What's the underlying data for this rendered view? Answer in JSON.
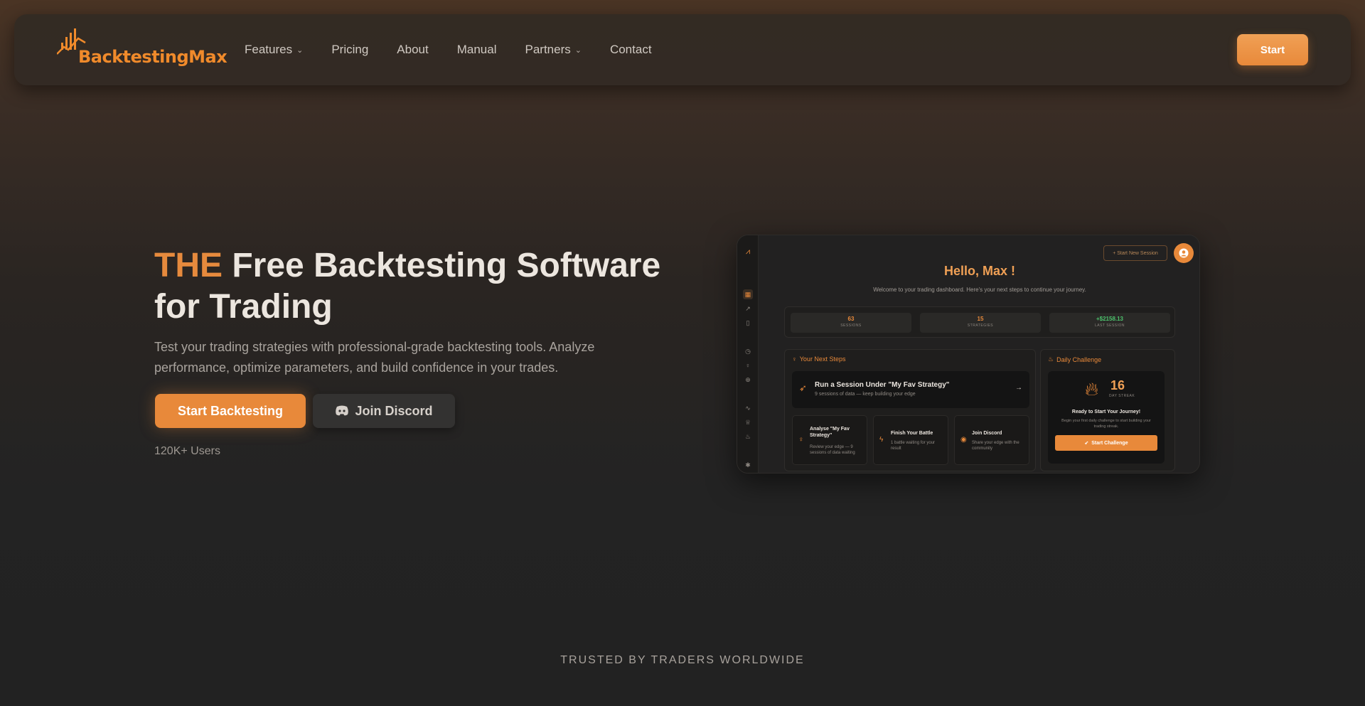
{
  "nav": {
    "logo_text": "BacktestingMax",
    "links": [
      {
        "label": "Features",
        "dropdown": true
      },
      {
        "label": "Pricing",
        "dropdown": false
      },
      {
        "label": "About",
        "dropdown": false
      },
      {
        "label": "Manual",
        "dropdown": false
      },
      {
        "label": "Partners",
        "dropdown": true
      },
      {
        "label": "Contact",
        "dropdown": false
      }
    ],
    "start_label": "Start"
  },
  "hero": {
    "title_accent": "THE",
    "title_rest": "Free Backtesting Software for Trading",
    "subtitle": "Test your trading strategies with professional-grade backtesting tools. Analyze performance, optimize parameters, and build confidence in your trades.",
    "primary_cta": "Start Backtesting",
    "secondary_cta": "Join Discord",
    "users": "120K+ Users"
  },
  "trusted": "TRUSTED BY TRADERS WORLDWIDE",
  "dashboard": {
    "new_session": "+ Start New Session",
    "hello": "Hello,  Max !",
    "welcome": "Welcome to your trading dashboard. Here's your next steps to continue your journey.",
    "stats": [
      {
        "value": "63",
        "label": "SESSIONS",
        "color": "#e8893a"
      },
      {
        "value": "15",
        "label": "STRATEGIES",
        "color": "#e8893a"
      },
      {
        "value": "+$2158.13",
        "label": "LAST SESSION",
        "color": "#4cc26c"
      }
    ],
    "next_steps": {
      "title": "Your Next Steps",
      "run_title": "Run a Session Under \"My Fav Strategy\"",
      "run_sub": "9 sessions of data — keep building your edge",
      "cards": [
        {
          "title": "Analyse \"My Fav Strategy\"",
          "sub": "Review your edge — 9 sessions of data waiting"
        },
        {
          "title": "Finish Your Battle",
          "sub": "1 battle waiting for your result"
        },
        {
          "title": "Join Discord",
          "sub": "Share your edge with the community"
        }
      ]
    },
    "challenge": {
      "title": "Daily Challenge",
      "streak": "16",
      "streak_label": "DAY STREAK",
      "ready": "Ready to Start Your Journey!",
      "ready_sub": "Begin your first daily challenge to start building your trading streak.",
      "button": "Start Challenge"
    }
  },
  "colors": {
    "accent": "#e8893a",
    "positive": "#4cc26c"
  }
}
